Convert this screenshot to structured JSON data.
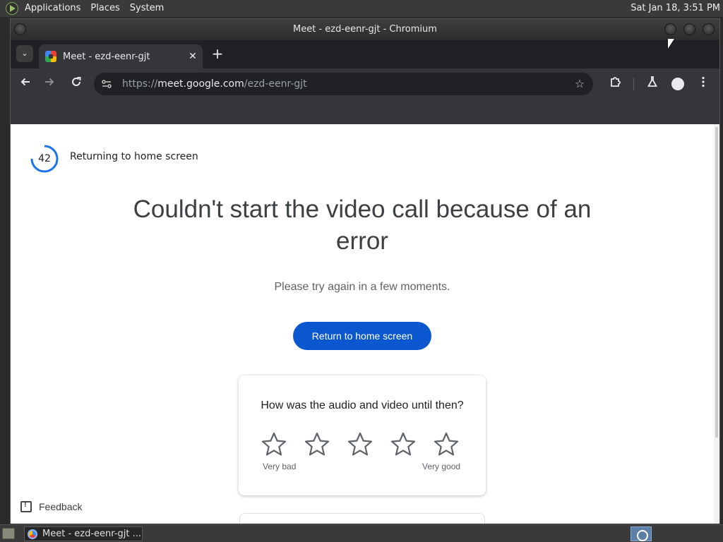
{
  "top_panel": {
    "menus": [
      "Applications",
      "Places",
      "System"
    ],
    "clock": "Sat Jan 18,  3:51 PM"
  },
  "window": {
    "title": "Meet - ezd-eenr-gjt - Chromium"
  },
  "browser": {
    "tab": {
      "title": "Meet - ezd-eenr-gjt",
      "close_glyph": "✕"
    },
    "new_tab_glyph": "+",
    "tab_search_glyph": "⌄",
    "url_scheme": "https://",
    "url_host": "meet.google.com",
    "url_path": "/ezd-eenr-gjt",
    "icons": {
      "back": "arrow-left-icon",
      "forward": "arrow-right-icon",
      "reload": "reload-icon",
      "star": "bookmark-star-icon",
      "extensions": "puzzle-icon",
      "labs": "flask-icon",
      "profile": "profile-icon",
      "menu": "kebab-menu-icon"
    }
  },
  "page": {
    "countdown": "42",
    "countdown_fraction": 0.75,
    "countdown_label": "Returning to home screen",
    "heading": "Couldn't start the video call because of an error",
    "subtext": "Please try again in a few moments.",
    "primary_button": "Return to home screen",
    "rating": {
      "question": "How was the audio and video until then?",
      "star_count": 5,
      "low_label": "Very bad",
      "high_label": "Very good"
    },
    "feedback": "Feedback",
    "accent_color": "#0b57d0",
    "countdown_color": "#1a73e8"
  },
  "taskbar": {
    "task_label": "Meet - ezd-eenr-gjt ..."
  }
}
